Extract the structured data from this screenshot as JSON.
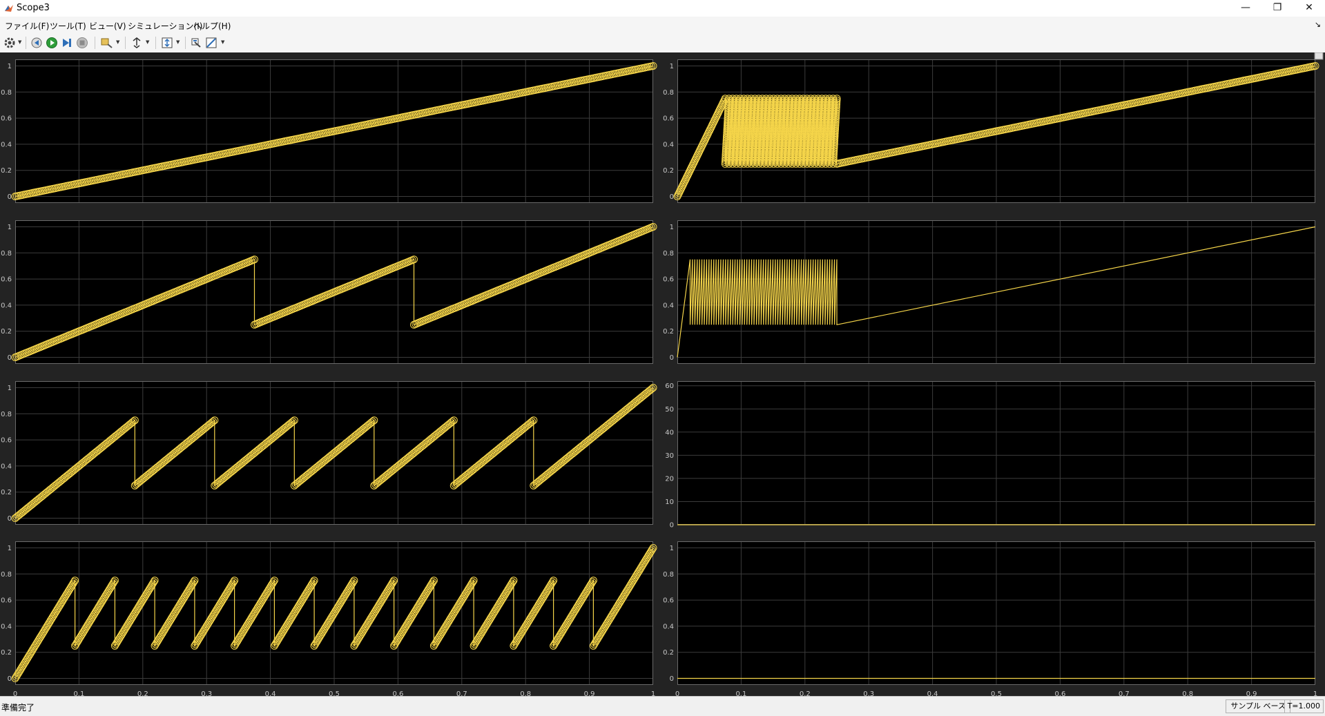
{
  "window": {
    "title": "Scope3",
    "minimize_glyph": "—",
    "restore_glyph": "❐",
    "close_glyph": "✕"
  },
  "menu": {
    "items": [
      "ファイル(F)",
      "ツール(T)",
      "ビュー(V)",
      "シミュレーション(I)",
      "ヘルプ(H)"
    ],
    "pin_glyph": "↘"
  },
  "toolbar": {
    "icons": [
      "settings-icon",
      "step-back-icon",
      "run-icon",
      "step-forward-icon",
      "stop-icon",
      "highlight-icon",
      "cursor-icon",
      "autoscale-icon",
      "data-cursor-icon",
      "measure-icon"
    ]
  },
  "axes": {
    "x_ticks": [
      "0",
      "0.1",
      "0.2",
      "0.3",
      "0.4",
      "0.5",
      "0.6",
      "0.7",
      "0.8",
      "0.9",
      "1"
    ],
    "y_ticks_unit": [
      "0",
      "0.2",
      "0.4",
      "0.6",
      "0.8",
      "1"
    ],
    "y_ticks_60": [
      "0",
      "10",
      "20",
      "30",
      "40",
      "50",
      "60"
    ]
  },
  "chart_data": [
    {
      "id": "left-1",
      "type": "line",
      "markers": true,
      "kind": "ramp",
      "periods": 1,
      "xlim": [
        0,
        1
      ],
      "ylim": [
        -0.05,
        1.05
      ],
      "color": "#f5d54a"
    },
    {
      "id": "left-2",
      "type": "line",
      "markers": true,
      "kind": "sawtooth",
      "resets": [
        0.375,
        0.625
      ],
      "low": 0.25,
      "high": 0.75,
      "xlim": [
        0,
        1
      ],
      "ylim": [
        -0.05,
        1.05
      ],
      "color": "#f5d54a"
    },
    {
      "id": "left-3",
      "type": "line",
      "markers": true,
      "kind": "sawtooth",
      "resets": [
        0.1875,
        0.3125,
        0.4375,
        0.5625,
        0.6875,
        0.8125
      ],
      "low": 0.25,
      "high": 0.75,
      "xlim": [
        0,
        1
      ],
      "ylim": [
        -0.05,
        1.05
      ],
      "color": "#f5d54a"
    },
    {
      "id": "left-4",
      "type": "line",
      "markers": true,
      "kind": "sawtooth",
      "resets": [
        0.09375,
        0.15625,
        0.21875,
        0.28125,
        0.34375,
        0.40625,
        0.46875,
        0.53125,
        0.59375,
        0.65625,
        0.71875,
        0.78125,
        0.84375,
        0.90625
      ],
      "low": 0.25,
      "high": 0.75,
      "xlim": [
        0,
        1
      ],
      "ylim": [
        -0.05,
        1.05
      ],
      "color": "#f5d54a"
    },
    {
      "id": "right-1",
      "type": "line",
      "markers": true,
      "kind": "sawtooth",
      "count": 31,
      "low": 0.25,
      "high": 0.75,
      "xlim": [
        0,
        1
      ],
      "ylim": [
        -0.05,
        1.05
      ],
      "color": "#f5d54a"
    },
    {
      "id": "right-2",
      "type": "line",
      "markers": false,
      "kind": "sawtooth",
      "count": 63,
      "low": 0.25,
      "high": 0.75,
      "xlim": [
        0,
        1
      ],
      "ylim": [
        -0.05,
        1.05
      ],
      "color": "#f5d54a"
    },
    {
      "id": "right-3",
      "type": "line",
      "markers": false,
      "kind": "constant",
      "value": 0,
      "xlim": [
        0,
        1
      ],
      "ylim": [
        0,
        62
      ],
      "color": "#f5d54a"
    },
    {
      "id": "right-4",
      "type": "line",
      "markers": false,
      "kind": "constant",
      "value": 0,
      "xlim": [
        0,
        1
      ],
      "ylim": [
        -0.05,
        1.05
      ],
      "color": "#f5d54a"
    }
  ],
  "status": {
    "left_text": "準備完了",
    "base": "サンプル ベース",
    "time": "T=1.000"
  }
}
